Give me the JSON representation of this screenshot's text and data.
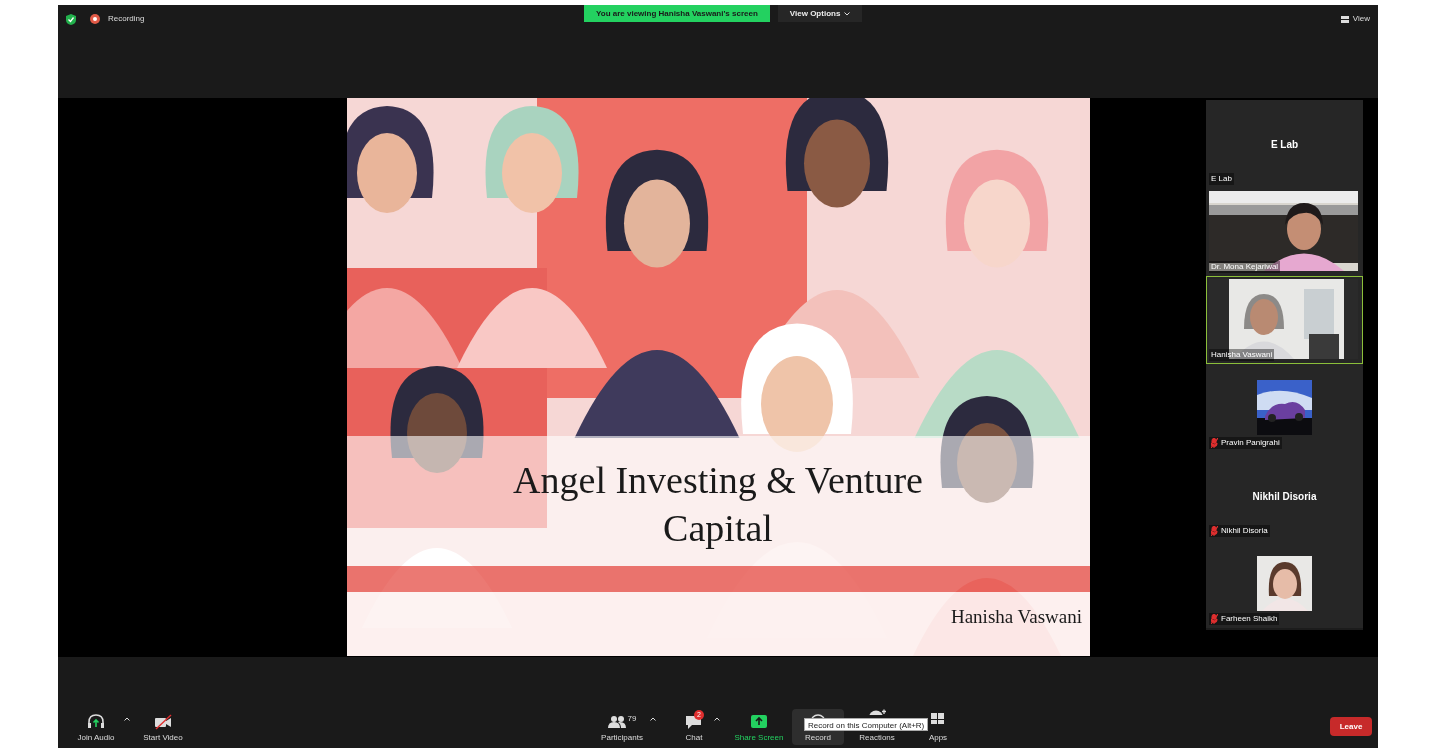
{
  "top_bar": {
    "recording_label": "Recording",
    "banner": "You are viewing Hanisha Vaswani's screen",
    "view_options": "View Options",
    "view": "View"
  },
  "slide": {
    "title": "Angel Investing & Venture Capital",
    "author": "Hanisha Vaswani"
  },
  "gallery": [
    {
      "kind": "name",
      "title": "E Lab",
      "label": "E Lab",
      "muted": false,
      "selected": false
    },
    {
      "kind": "video",
      "label": "Dr. Mona Kejariwal",
      "muted": false,
      "selected": false
    },
    {
      "kind": "video",
      "label": "Hanisha Vaswani",
      "muted": false,
      "selected": true
    },
    {
      "kind": "avatar",
      "label": "Pravin Panigrahi",
      "muted": true,
      "selected": false
    },
    {
      "kind": "name",
      "title": "Nikhil Disoria",
      "label": "Nikhil Disoria",
      "muted": true,
      "selected": false
    },
    {
      "kind": "avatar",
      "label": "Farheen Shaikh",
      "muted": true,
      "selected": false
    }
  ],
  "toolbar": {
    "items": [
      {
        "kind": "audio",
        "label": "Join Audio",
        "caret": true,
        "highlighted": false
      },
      {
        "kind": "video",
        "label": "Start Video",
        "caret": false,
        "highlighted": false
      },
      {
        "kind": "participants",
        "label": "Participants",
        "count": "79",
        "caret": true,
        "highlighted": false
      },
      {
        "kind": "chat",
        "label": "Chat",
        "badge": "2",
        "caret": true,
        "highlighted": false
      },
      {
        "kind": "share",
        "label": "Share Screen",
        "caret": false,
        "highlighted": false
      },
      {
        "kind": "record",
        "label": "Record",
        "caret": false,
        "highlighted": true
      },
      {
        "kind": "reactions",
        "label": "Reactions",
        "caret": false,
        "highlighted": false
      },
      {
        "kind": "apps",
        "label": "Apps",
        "caret": false,
        "highlighted": false
      }
    ],
    "tooltip": "Record on this Computer (Alt+R)",
    "leave": "Leave"
  }
}
